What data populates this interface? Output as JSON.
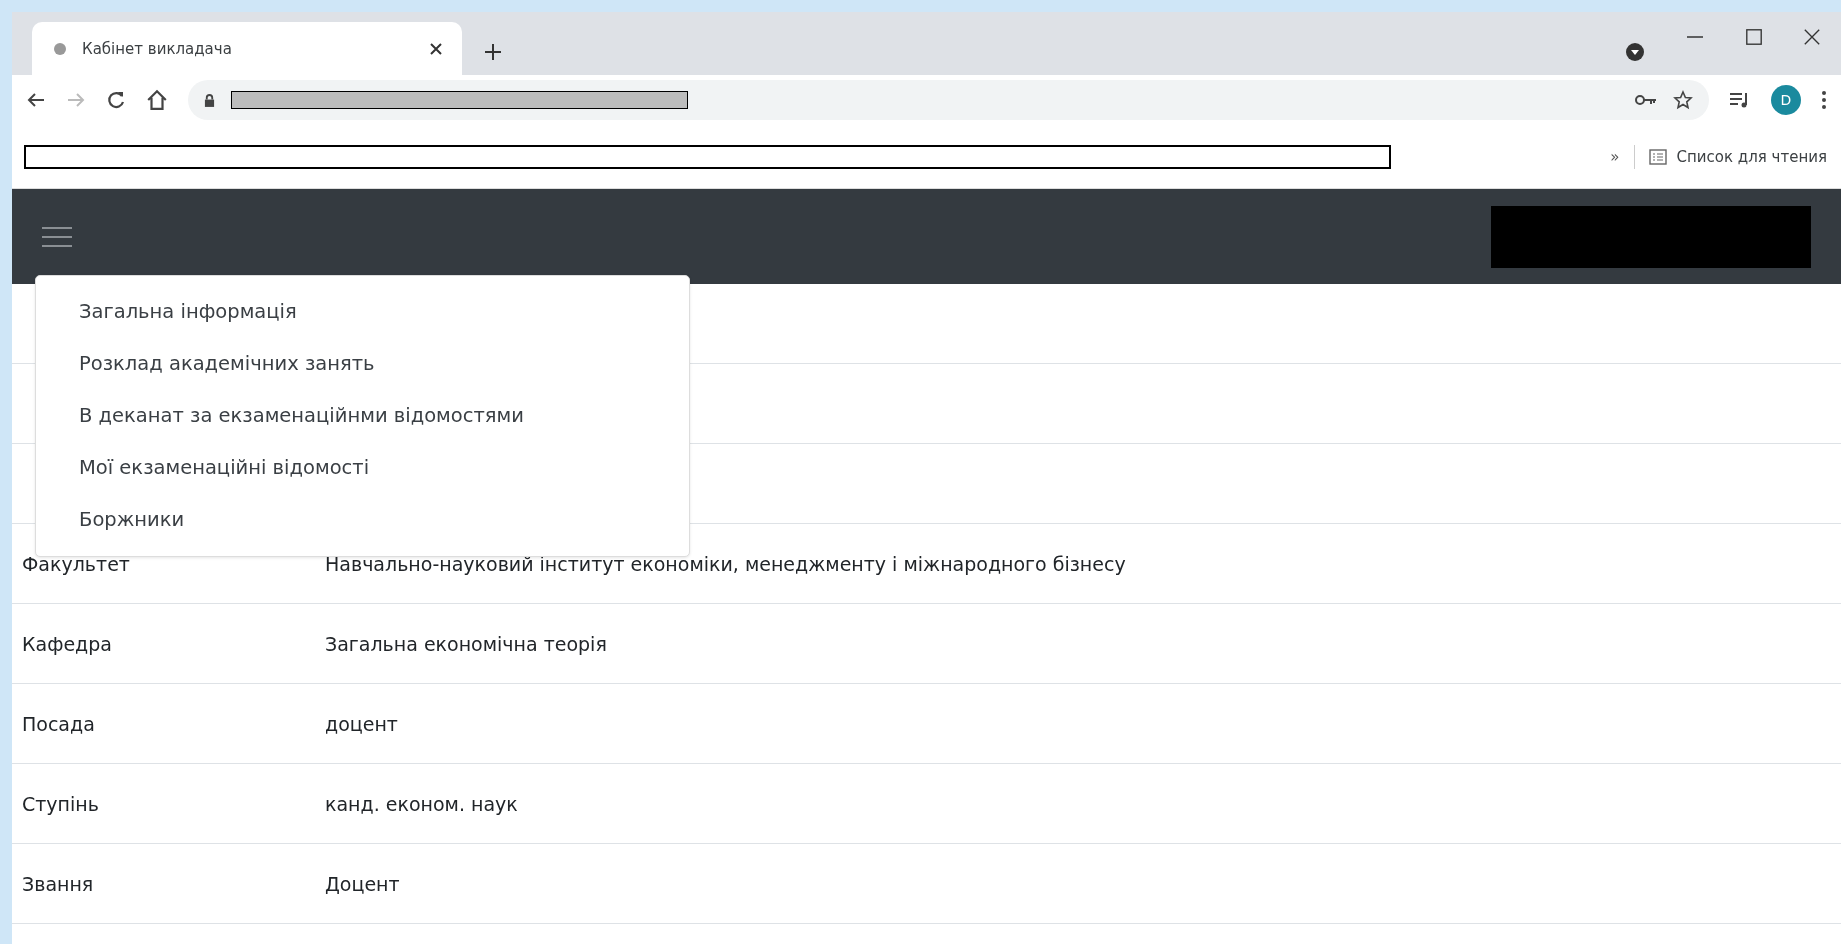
{
  "browser": {
    "tab_title": "Кабінет викладача",
    "profile_initial": "D",
    "bookmarks_overflow": "»",
    "reading_list": "Список для чтения"
  },
  "menu": {
    "items": [
      {
        "label": "Загальна інформація"
      },
      {
        "label": "Розклад академічних занять"
      },
      {
        "label": "В деканат за екзаменаційнми відомостями"
      },
      {
        "label": "Мої екзаменаційні відомості"
      },
      {
        "label": "Боржники"
      }
    ]
  },
  "table": {
    "rows": [
      {
        "label": "Факультет",
        "value": "Навчально-науковий інститут економіки, менеджменту і міжнародного бізнесу"
      },
      {
        "label": "Кафедра",
        "value": "Загальна економічна теорія"
      },
      {
        "label": "Посада",
        "value": "доцент"
      },
      {
        "label": "Ступінь",
        "value": "канд. економ. наук"
      },
      {
        "label": "Звання",
        "value": "Доцент"
      }
    ]
  }
}
